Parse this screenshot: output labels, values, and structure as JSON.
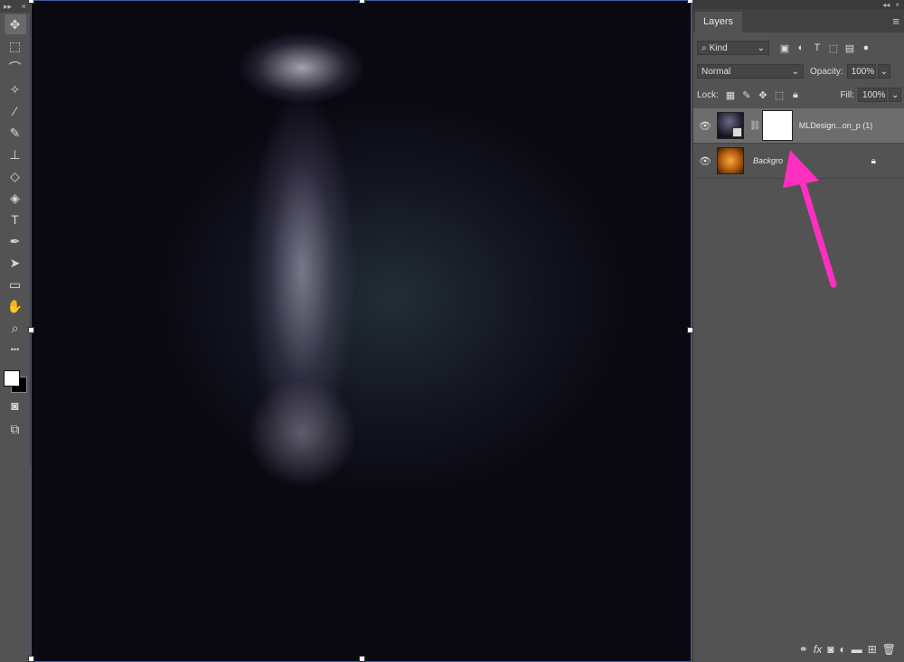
{
  "toolbar": {
    "collapse_glyph": "▸▸",
    "close_glyph": "×",
    "tools": [
      {
        "name": "move-tool",
        "icon": "move-icon",
        "glyph": "✥"
      },
      {
        "name": "marquee-tool",
        "icon": "marquee-icon",
        "glyph": "⬚"
      },
      {
        "name": "lasso-tool",
        "icon": "lasso-icon",
        "glyph": "⌒"
      },
      {
        "name": "magic-wand-tool",
        "icon": "magic-wand-icon",
        "glyph": "✧"
      },
      {
        "name": "eyedropper-tool",
        "icon": "eyedropper-icon",
        "glyph": "⁄"
      },
      {
        "name": "brush-tool",
        "icon": "brush-icon",
        "glyph": "✎"
      },
      {
        "name": "stamp-tool",
        "icon": "stamp-icon",
        "glyph": "⊥"
      },
      {
        "name": "eraser-tool",
        "icon": "eraser-icon",
        "glyph": "◇"
      },
      {
        "name": "paint-bucket-tool",
        "icon": "paint-bucket-icon",
        "glyph": "◈"
      },
      {
        "name": "type-tool",
        "icon": "type-icon",
        "glyph": "T"
      },
      {
        "name": "pen-tool",
        "icon": "pen-icon",
        "glyph": "✒"
      },
      {
        "name": "path-selection-tool",
        "icon": "arrow-pointer-icon",
        "glyph": "➤"
      },
      {
        "name": "rectangle-tool",
        "icon": "rectangle-icon",
        "glyph": "▭"
      },
      {
        "name": "hand-tool",
        "icon": "hand-icon",
        "glyph": "✋"
      },
      {
        "name": "zoom-tool",
        "icon": "zoom-icon",
        "glyph": "⌕"
      },
      {
        "name": "more-tools",
        "icon": "ellipsis-icon",
        "glyph": "•••"
      }
    ],
    "extra": [
      {
        "name": "quick-mask-button",
        "icon": "quick-mask-icon",
        "glyph": "◙"
      },
      {
        "name": "screen-mode-button",
        "icon": "screen-mode-icon",
        "glyph": "⧉"
      }
    ]
  },
  "panel": {
    "tab_label": "Layers",
    "collapse_glyph": "◂◂",
    "close_glyph": "×",
    "menu_glyph": "≡",
    "filter_label": "Kind",
    "blend_mode": "Normal",
    "opacity_label": "Opacity:",
    "opacity_value": "100%",
    "lock_label": "Lock:",
    "fill_label": "Fill:",
    "fill_value": "100%",
    "layers": [
      {
        "name": "MLDesign...on_p (1)",
        "visible": true,
        "selected": true,
        "has_mask": true
      },
      {
        "name": "Backgro",
        "visible": true,
        "selected": false,
        "locked": true
      }
    ],
    "bottom_icons": [
      "link-icon",
      "fx-icon",
      "add-mask-icon",
      "adjustment-icon",
      "folder-icon",
      "new-layer-icon",
      "trash-icon"
    ]
  },
  "colors": {
    "ui_bg": "#535353",
    "selected_layer": "#6d6d6d",
    "annotation_arrow": "#ff2fc0"
  }
}
